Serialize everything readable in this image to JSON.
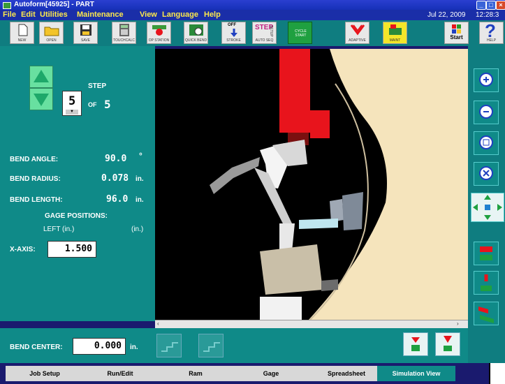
{
  "window": {
    "title": "Autoform[45925] - PART"
  },
  "menu": {
    "items": [
      "File",
      "Edit",
      "Utilities",
      "Maintenance",
      "View",
      "Language",
      "Help"
    ],
    "date": "Jul 22, 2009",
    "time": "12:28:3"
  },
  "toolbar": {
    "buttons": [
      {
        "label": "NEW",
        "icon": "document-icon"
      },
      {
        "label": "OPEN",
        "icon": "folder-icon"
      },
      {
        "label": "SAVE",
        "icon": "floppy-icon"
      },
      {
        "label": "TOUCHCALC",
        "icon": "calculator-icon"
      },
      {
        "label": "OP STATION",
        "icon": "op-station-icon"
      },
      {
        "label": "QUICK BEND",
        "icon": "quick-bend-icon"
      },
      {
        "label": "STROKE",
        "icon": "stroke-icon"
      },
      {
        "label": "AUTO SEQ",
        "icon": "step-icon"
      },
      {
        "label": "CYCLE START",
        "icon": "cycle-start-icon"
      },
      {
        "label": "ADAPTIVE",
        "icon": "adaptive-icon"
      },
      {
        "label": "MAINT",
        "icon": "maint-icon"
      },
      {
        "label": "Start",
        "icon": "windows-start-icon"
      },
      {
        "label": "HELP",
        "icon": "help-icon"
      }
    ],
    "off_label": "OFF",
    "step_word": "STEP",
    "setup_word": "SETUP"
  },
  "step": {
    "title": "STEP",
    "current": "5",
    "of_label": "OF",
    "total": "5"
  },
  "bend": {
    "angle_label": "BEND ANGLE:",
    "angle_value": "90.0",
    "angle_unit": "°",
    "radius_label": "BEND RADIUS:",
    "radius_value": "0.078",
    "radius_unit": "in.",
    "length_label": "BEND LENGTH:",
    "length_value": "96.0",
    "length_unit": "in."
  },
  "gage": {
    "title": "GAGE POSITIONS:",
    "left_label": "LEFT (in.)",
    "right_label": "(in.)",
    "x_axis_label": "X-AXIS:",
    "x_axis_value": "1.500"
  },
  "bend_center": {
    "label": "BEND CENTER:",
    "value": "0.000",
    "unit": "in."
  },
  "tabs": [
    "Job Setup",
    "Run/Edit",
    "Ram",
    "Gage",
    "Spreadsheet",
    "Simulation View"
  ],
  "active_tab": "Simulation View",
  "colors": {
    "panel": "#0f8a88",
    "menu_text": "#ffe94a",
    "title_bar": "#1630b8",
    "ram_red": "#e8141c"
  }
}
